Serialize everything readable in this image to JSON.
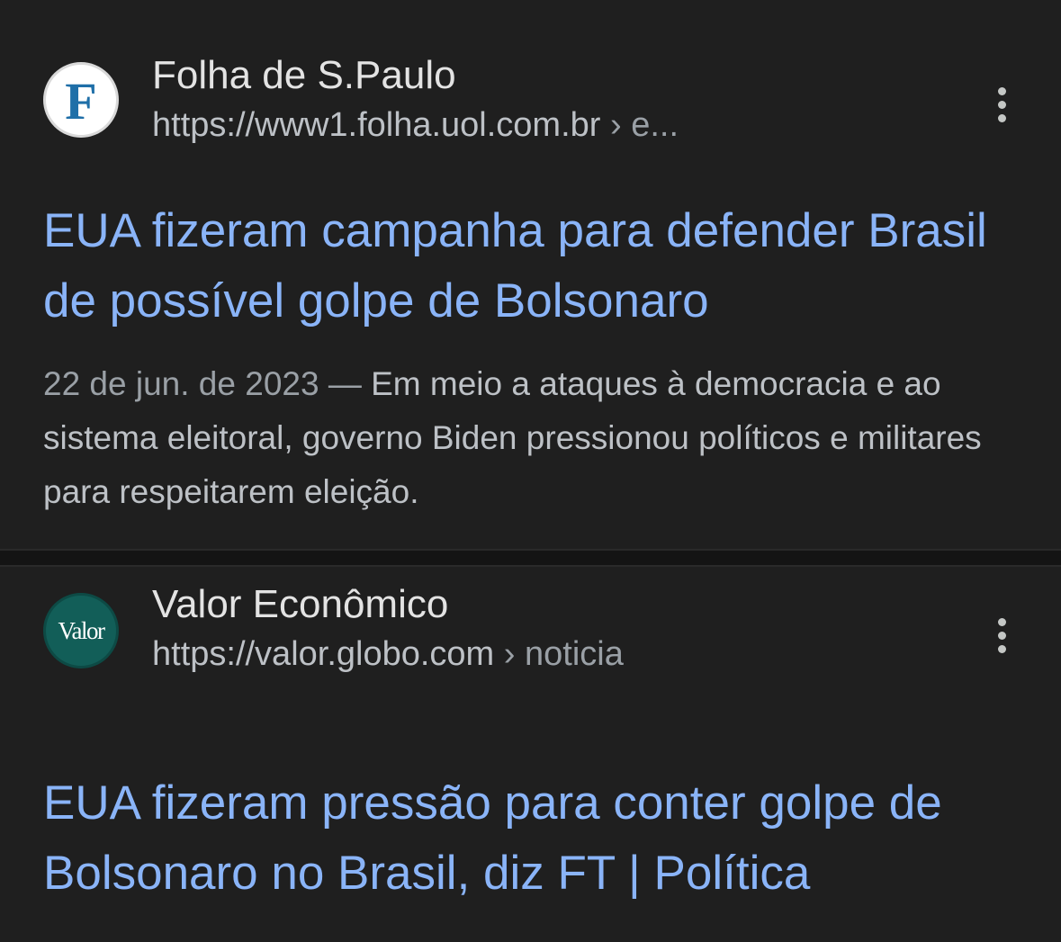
{
  "results": [
    {
      "favicon_letter": "F",
      "site_name": "Folha de S.Paulo",
      "url": "https://www1.folha.uol.com.br",
      "breadcrumb": "› e...",
      "title": "EUA fizeram campanha para defender Brasil de possível golpe de Bolsonaro",
      "date": "22 de jun. de 2023 —",
      "snippet": "Em meio a ataques à democracia e ao sistema eleitoral, governo Biden pressionou políticos e militares para respeitarem eleição."
    },
    {
      "favicon_letter": "Valor",
      "site_name": "Valor Econômico",
      "url": "https://valor.globo.com",
      "breadcrumb": "› noticia",
      "title": "EUA fizeram pressão para conter golpe de Bolsonaro no Brasil, diz FT | Política"
    }
  ],
  "colors": {
    "background": "#1f1f1f",
    "title_link": "#8ab4f8",
    "text_secondary": "#bdc1c6",
    "folha_blue": "#1f6fa8",
    "valor_teal": "#125e58"
  },
  "icons": {
    "more_options": "more-vert-icon"
  }
}
